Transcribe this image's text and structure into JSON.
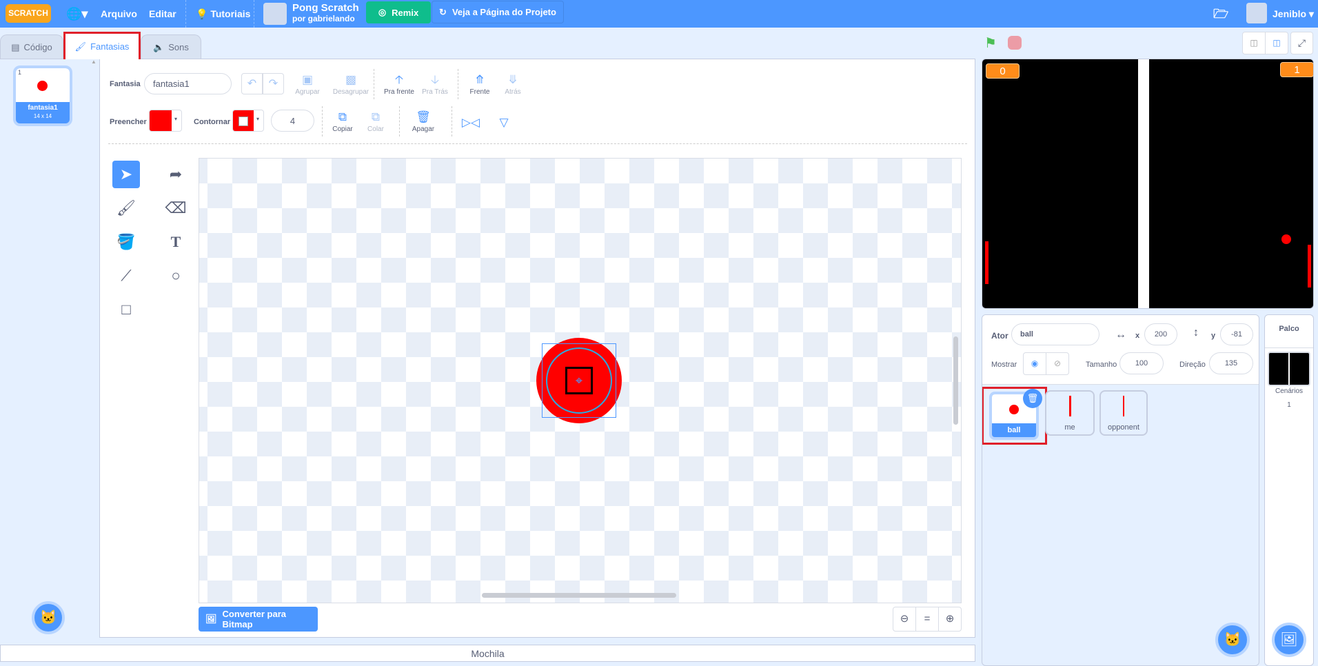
{
  "menubar": {
    "logo": "SCRATCH",
    "language_icon": "globe-icon",
    "file": "Arquivo",
    "edit": "Editar",
    "tutorials": "Tutoriais",
    "project_title": "Pong Scratch",
    "project_author": "por gabrielando",
    "remix": "Remix",
    "see_project_page": "Veja a Página do Projeto",
    "username": "Jeniblo"
  },
  "tabs": [
    {
      "label": "Código"
    },
    {
      "label": "Fantasias",
      "active": true
    },
    {
      "label": "Sons"
    }
  ],
  "costume_list": [
    {
      "index": "1",
      "name": "fantasia1",
      "size": "14 x 14",
      "selected": true
    }
  ],
  "paint": {
    "costume_label": "Fantasia",
    "costume_name": "fantasia1",
    "group": "Agrupar",
    "ungroup": "Desagrupar",
    "forward": "Pra frente",
    "backward": "Pra Trás",
    "front": "Frente",
    "back": "Atrás",
    "fill_label": "Preencher",
    "fill_color": "#ff0000",
    "outline_label": "Contornar",
    "outline_color": "#ff0000",
    "outline_width": "4",
    "copy": "Copiar",
    "paste": "Colar",
    "delete": "Apagar",
    "convert": "Converter para Bitmap",
    "zoom_reset": "="
  },
  "backpack": "Mochila",
  "stage": {
    "score_left": "0",
    "score_right": "1",
    "variable_color": "#ff8c1a"
  },
  "sprite_info": {
    "sprite_label": "Ator",
    "sprite_name": "ball",
    "x_label": "x",
    "x": "200",
    "y_label": "y",
    "y": "-81",
    "show_label": "Mostrar",
    "size_label": "Tamanho",
    "size": "100",
    "direction_label": "Direção",
    "direction": "135"
  },
  "sprites": [
    {
      "name": "ball",
      "selected": true
    },
    {
      "name": "me"
    },
    {
      "name": "opponent"
    }
  ],
  "stage_panel": {
    "title": "Palco",
    "backdrops_label": "Cenários",
    "backdrops_count": "1"
  }
}
